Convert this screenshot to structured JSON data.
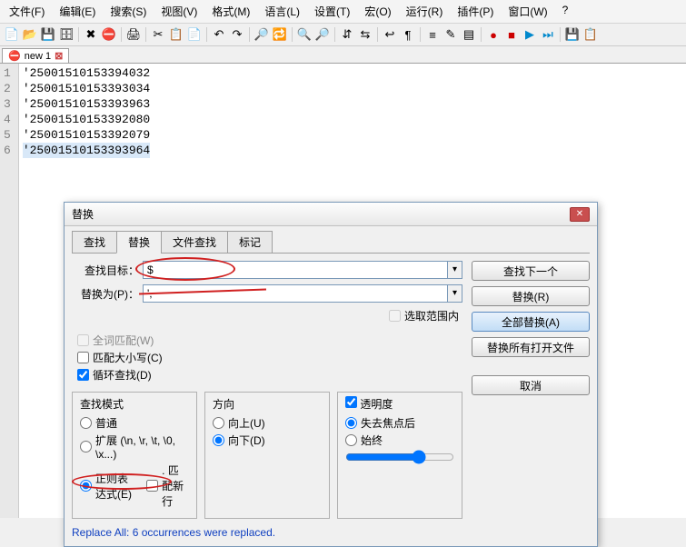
{
  "menu": [
    "文件(F)",
    "编辑(E)",
    "搜索(S)",
    "视图(V)",
    "格式(M)",
    "语言(L)",
    "设置(T)",
    "宏(O)",
    "运行(R)",
    "插件(P)",
    "窗口(W)",
    "?"
  ],
  "toolbar_icons": [
    {
      "n": "new-icon",
      "g": "📄"
    },
    {
      "n": "open-icon",
      "g": "📂"
    },
    {
      "n": "save-icon",
      "g": "💾"
    },
    {
      "n": "save-all-icon",
      "g": "🗄"
    },
    {
      "n": "sep"
    },
    {
      "n": "close-icon",
      "g": "✖"
    },
    {
      "n": "close-all-icon",
      "g": "⛔"
    },
    {
      "n": "sep"
    },
    {
      "n": "print-icon",
      "g": "🖨"
    },
    {
      "n": "sep"
    },
    {
      "n": "cut-icon",
      "g": "✂"
    },
    {
      "n": "copy-icon",
      "g": "📋"
    },
    {
      "n": "paste-icon",
      "g": "📄"
    },
    {
      "n": "sep"
    },
    {
      "n": "undo-icon",
      "g": "↶"
    },
    {
      "n": "redo-icon",
      "g": "↷"
    },
    {
      "n": "sep"
    },
    {
      "n": "find-icon",
      "g": "🔎"
    },
    {
      "n": "replace-icon",
      "g": "🔁"
    },
    {
      "n": "sep"
    },
    {
      "n": "zoom-in-icon",
      "g": "🔍"
    },
    {
      "n": "zoom-out-icon",
      "g": "🔎"
    },
    {
      "n": "sep"
    },
    {
      "n": "sync-v-icon",
      "g": "⇵"
    },
    {
      "n": "sync-h-icon",
      "g": "⇆"
    },
    {
      "n": "sep"
    },
    {
      "n": "wrap-icon",
      "g": "↩"
    },
    {
      "n": "all-chars-icon",
      "g": "¶"
    },
    {
      "n": "sep"
    },
    {
      "n": "indent-guide-icon",
      "g": "≡"
    },
    {
      "n": "lang-icon",
      "g": "✎"
    },
    {
      "n": "doc-map-icon",
      "g": "▤"
    },
    {
      "n": "sep"
    },
    {
      "n": "record-icon",
      "g": "●",
      "c": "#c00"
    },
    {
      "n": "stop-icon",
      "g": "■",
      "c": "#c00"
    },
    {
      "n": "play-icon",
      "g": "▶",
      "c": "#08c"
    },
    {
      "n": "ff-icon",
      "g": "⏭",
      "c": "#08c"
    },
    {
      "n": "sep"
    },
    {
      "n": "save-macro-icon",
      "g": "💾"
    },
    {
      "n": "misc-icon",
      "g": "📋"
    }
  ],
  "file_tab": {
    "name": "new 1",
    "dirty_glyph": "⛔",
    "close_glyph": "⊠"
  },
  "lines": [
    "'25001510153394032",
    "'25001510153393034",
    "'25001510153393963",
    "'25001510153392080",
    "'25001510153392079",
    "'25001510153393964"
  ],
  "dialog": {
    "title": "替换",
    "tabs": [
      "查找",
      "替换",
      "文件查找",
      "标记"
    ],
    "active_tab_index": 1,
    "find_label": "查找目标：",
    "find_value": "$",
    "replace_label": "替换为(P)：",
    "replace_value": "',",
    "in_range": "选取范围内",
    "buttons": {
      "find_next": "查找下一个",
      "replace": "替换(R)",
      "replace_all": "全部替换(A)",
      "replace_in_open": "替换所有打开文件",
      "cancel": "取消"
    },
    "options": {
      "whole_word": "全词匹配(W)",
      "match_case": "匹配大小写(C)",
      "wrap": "循环查找(D)"
    },
    "search_mode": {
      "legend": "查找模式",
      "normal": "普通",
      "extended": "扩展 (\\n, \\r, \\t, \\0, \\x...)",
      "regex": "正则表达式(E)",
      "newline": ". 匹配新行"
    },
    "direction": {
      "legend": "方向",
      "up": "向上(U)",
      "down": "向下(D)"
    },
    "transparency": {
      "legend": "透明度",
      "on_lose_focus": "失去焦点后",
      "always": "始终"
    },
    "status": "Replace All: 6 occurrences were replaced."
  }
}
